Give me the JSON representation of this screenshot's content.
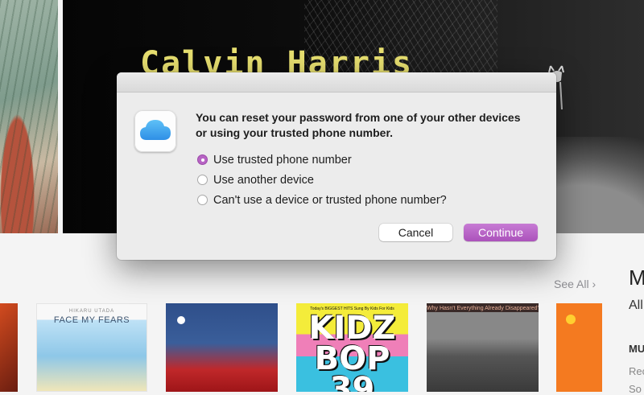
{
  "background": {
    "hero_title": "Calvin Harris",
    "see_all_label": "See All",
    "see_all_chevron": "›",
    "right_column": {
      "heading_letter": "M",
      "all_label": "All",
      "section_label": "MU",
      "link_1": "Rec",
      "link_2": "So"
    },
    "albums": [
      {
        "caption": ""
      },
      {
        "artist": "HIKARU UTADA",
        "title": "FACE MY FEARS"
      },
      {
        "caption": ""
      },
      {
        "tagline": "Today's BIGGEST HITS Sung By Kids For Kids",
        "logo": "KIDZ BOP",
        "number": "39"
      },
      {
        "caption": "Why Hasn't Everything Already Disappeared?"
      },
      {
        "caption": ""
      }
    ]
  },
  "dialog": {
    "icon": "icloud-icon",
    "message": "You can reset your password from one of your other devices or using your trusted phone number.",
    "options": [
      {
        "label": "Use trusted phone number",
        "selected": true
      },
      {
        "label": "Use another device",
        "selected": false
      },
      {
        "label": "Can't use a device or trusted phone number?",
        "selected": false
      }
    ],
    "cancel_label": "Cancel",
    "continue_label": "Continue",
    "accent_color": "#b764c4"
  }
}
